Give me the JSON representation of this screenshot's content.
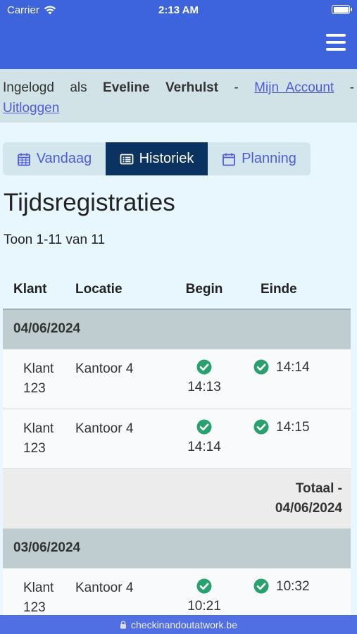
{
  "statusbar": {
    "carrier": "Carrier",
    "time": "2:13 AM"
  },
  "colors": {
    "header": "#3d64dd",
    "active_tab": "#0b3362",
    "link": "#4f5cd9",
    "success": "#28a16e"
  },
  "login": {
    "prefix": "Ingelogd",
    "word_as": "als",
    "first_name": "Eveline",
    "last_name": "Verhulst",
    "sep": "-",
    "account_link": "Mijn  Account",
    "logout_link": "Uitloggen"
  },
  "tabs": [
    {
      "label": "Vandaag",
      "icon": "calendar-grid-icon"
    },
    {
      "label": "Historiek",
      "icon": "list-card-icon"
    },
    {
      "label": "Planning",
      "icon": "calendar-icon"
    }
  ],
  "page_title": "Tijdsregistraties",
  "count_text": "Toon 1-11 van 11",
  "table": {
    "headers": [
      "Klant",
      "Locatie",
      "Begin",
      "Einde"
    ],
    "groups": [
      {
        "date": "04/06/2024",
        "rows": [
          {
            "klant1": "Klant",
            "klant2": "123",
            "locatie": "Kantoor 4",
            "begin": "14:13",
            "einde": "14:14"
          },
          {
            "klant1": "Klant",
            "klant2": "123",
            "locatie": "Kantoor 4",
            "begin": "14:14",
            "einde": "14:15"
          }
        ],
        "total1": "Totaal -",
        "total2": "04/06/2024"
      },
      {
        "date": "03/06/2024",
        "rows": [
          {
            "klant1": "Klant",
            "klant2": "123",
            "locatie": "Kantoor 4",
            "begin": "10:21",
            "einde": "10:32"
          }
        ]
      }
    ]
  },
  "url": "checkinandoutatwork.be"
}
